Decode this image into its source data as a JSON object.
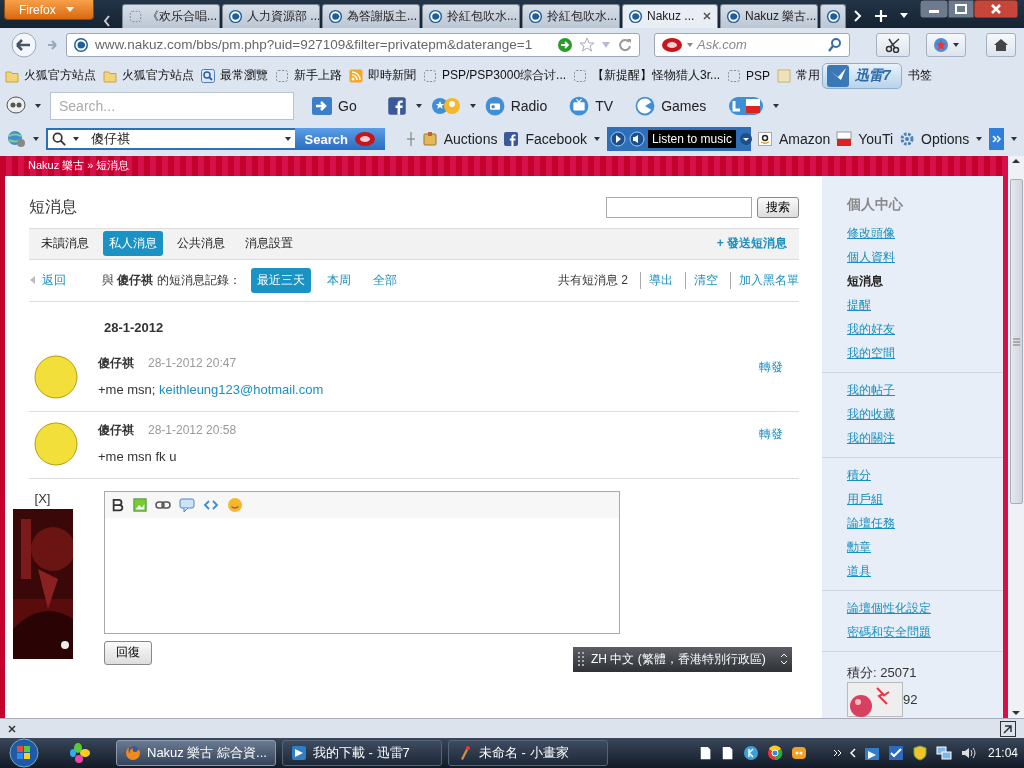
{
  "tab_strip": {
    "menu_button": "Firefox",
    "tabs": [
      {
        "kind": "blank",
        "title": "《欢乐合唱...",
        "selected": false
      },
      {
        "kind": "site",
        "title": "人力資源部 ...",
        "selected": false
      },
      {
        "kind": "site",
        "title": "為答謝版主...",
        "selected": false
      },
      {
        "kind": "site",
        "title": "拎紅包吹水...",
        "selected": false
      },
      {
        "kind": "site",
        "title": "拎紅包吹水...",
        "selected": false
      },
      {
        "kind": "site",
        "title": "Nakuz ...",
        "selected": true
      },
      {
        "kind": "site",
        "title": "Nakuz 樂古...",
        "selected": false
      },
      {
        "kind": "site",
        "selected": false
      }
    ]
  },
  "nav_bar": {
    "url": "www.nakuz.com/bbs/pm.php?uid=927109&filter=privatepm&daterange=1",
    "search_placeholder": "Ask.com"
  },
  "bookmarks": [
    {
      "kind": "folder",
      "label": "火狐官方站点"
    },
    {
      "kind": "folder",
      "label": "火狐官方站点"
    },
    {
      "kind": "search",
      "label": "最常瀏覽"
    },
    {
      "kind": "blank",
      "label": "新手上路"
    },
    {
      "kind": "rss",
      "label": "即時新聞"
    },
    {
      "kind": "blank",
      "label": "PSP/PSP3000综合讨..."
    },
    {
      "kind": "blank",
      "label": "【新提醒】怪物猎人3r..."
    },
    {
      "kind": "blank",
      "label": "PSP"
    },
    {
      "kind": "note",
      "label": "常用"
    },
    {
      "kind": "plain",
      "label": "书签"
    }
  ],
  "download_badge": "迅雷7",
  "toolbar_1": {
    "search_placeholder": "Search...",
    "go": "Go",
    "items": [
      {
        "kind": "radio",
        "label": "Radio"
      },
      {
        "kind": "tv",
        "label": "TV"
      },
      {
        "kind": "games",
        "label": "Games"
      }
    ]
  },
  "toolbar_2": {
    "query": "傻仔祺",
    "search_button": "Search",
    "items": [
      {
        "kind": "auctions",
        "label": "Auctions"
      },
      {
        "kind": "facebook",
        "label": "Facebook"
      }
    ],
    "music": "Listen to music",
    "links": [
      {
        "kind": "amazon",
        "label": "Amazon"
      },
      {
        "kind": "youtube",
        "label": "YouTi"
      },
      {
        "kind": "options",
        "label": "Options"
      }
    ]
  },
  "page": {
    "breadcrumb": "Nakuz 樂古 » 短消息",
    "title": "短消息",
    "search_button": "搜索",
    "tabs": [
      {
        "label": "未讀消息",
        "selected": false
      },
      {
        "label": "私人消息",
        "selected": true
      },
      {
        "label": "公共消息",
        "selected": false
      },
      {
        "label": "消息設置",
        "selected": false
      }
    ],
    "send_link": "+ 發送短消息",
    "back_link": "返回",
    "filter_label": "與 **傻仔祺** 的短消息記錄：",
    "filters": [
      {
        "label": "最近三天",
        "selected": true
      },
      {
        "label": "本周",
        "selected": false
      },
      {
        "label": "全部",
        "selected": false
      }
    ],
    "count": "共有短消息 2",
    "actions": [
      "導出",
      "清空",
      "加入黑名單"
    ],
    "date": "28-1-2012",
    "messages": [
      {
        "author": "傻仔祺",
        "time": "28-1-2012 20:47",
        "text": "+me msn; ",
        "link": "keithleung123@hotmail.com",
        "forward": "轉發"
      },
      {
        "author": "傻仔祺",
        "time": "28-1-2012 20:58",
        "text": "+me msn fk u",
        "forward": "轉發"
      }
    ],
    "reply_button": "回復",
    "ad_close": "[X]"
  },
  "sidebar": {
    "title": "個人中心",
    "groups": [
      [
        {
          "label": "修改頭像",
          "selected": false
        },
        {
          "label": "個人資料",
          "selected": false
        },
        {
          "label": "短消息",
          "selected": true
        },
        {
          "label": "提醒",
          "selected": false
        },
        {
          "label": "我的好友",
          "selected": false
        },
        {
          "label": "我的空間",
          "selected": false
        }
      ],
      [
        {
          "label": "我的帖子",
          "selected": false
        },
        {
          "label": "我的收藏",
          "selected": false
        },
        {
          "label": "我的關注",
          "selected": false
        }
      ],
      [
        {
          "label": "積分",
          "selected": false
        },
        {
          "label": "用戶組",
          "selected": false
        },
        {
          "label": "論壇任務",
          "selected": false
        },
        {
          "label": "勳章",
          "selected": false
        },
        {
          "label": "道具",
          "selected": false
        }
      ],
      [
        {
          "label": "論壇個性化設定",
          "selected": false
        },
        {
          "label": "密碼和安全問題",
          "selected": false
        }
      ]
    ],
    "stats": [
      "積分: 25071",
      "92"
    ]
  },
  "ime_bar": "ZH 中文 (繁體，香港特別行政區)",
  "taskbar": {
    "tasks": [
      {
        "kind": "firefox",
        "label": "Nakuz 樂古 綜合資...",
        "selected": true
      },
      {
        "kind": "thunder",
        "label": "我的下載 - 迅雷7",
        "selected": false
      },
      {
        "kind": "paint",
        "label": "未命名 - 小畫家",
        "selected": false
      }
    ],
    "clock": "21:04"
  }
}
